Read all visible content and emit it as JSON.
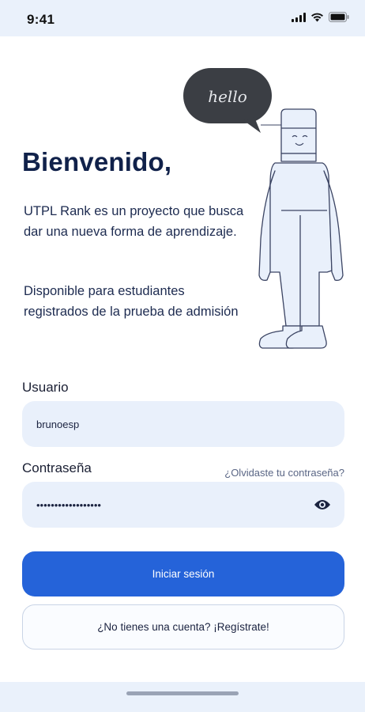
{
  "status_bar": {
    "time": "9:41"
  },
  "hero": {
    "title": "Bienvenido,",
    "paragraph1": "UTPL Rank es un proyecto que busca dar una nueva forma de aprendizaje.",
    "paragraph2": "Disponible para estudiantes registrados de la prueba de admisión",
    "speech_bubble_text": "hello"
  },
  "form": {
    "username_label": "Usuario",
    "username_value": "brunoesp",
    "password_label": "Contraseña",
    "password_value": "••••••••••••••••••",
    "forgot_password": "¿Olvidaste tu contraseña?"
  },
  "actions": {
    "login_label": "Iniciar sesión",
    "register_label": "¿No tienes una cuenta? ¡Regístrate!"
  },
  "colors": {
    "primary": "#2563d9",
    "input_bg": "#e9f0fb",
    "title": "#10214a"
  }
}
